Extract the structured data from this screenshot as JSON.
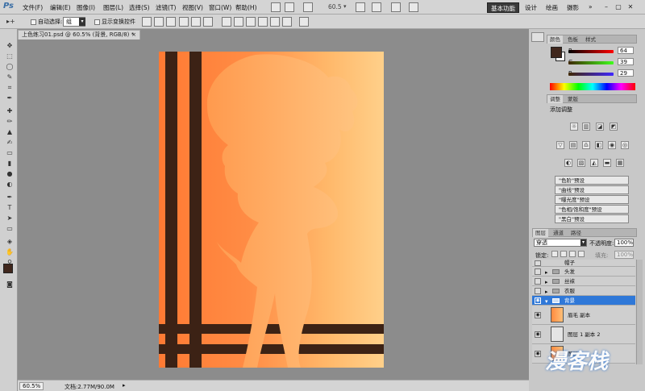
{
  "app": {
    "logo": "Ps"
  },
  "menu": [
    "文件(F)",
    "编辑(E)",
    "图像(I)",
    "图层(L)",
    "选择(S)",
    "滤镜(T)",
    "视图(V)",
    "窗口(W)",
    "帮助(H)"
  ],
  "app_toolbar": {
    "zoom": "60.5",
    "zoom_arrow": "▾"
  },
  "workspaces": [
    "基本功能",
    "设计",
    "绘画",
    "摄影"
  ],
  "workspace_more": "»",
  "window_controls": {
    "minimize": "–",
    "maximize": "▢",
    "close": "✕"
  },
  "options": {
    "tool_icon": "▸+",
    "auto_select_label": "自动选择:",
    "auto_select_value": "组",
    "transform_label": "显示变换控件"
  },
  "document": {
    "tab_title": "上色练习01.psd @ 60.5% (背景, RGB/8) *",
    "tab_close": "×",
    "zoom_status": "60.5%",
    "doc_status": "文档:2.77M/90.0M",
    "status_arrow": "▸"
  },
  "color_panel": {
    "tabs": [
      "颜色",
      "色板",
      "样式"
    ],
    "channels": [
      {
        "label": "R",
        "value": "64"
      },
      {
        "label": "G",
        "value": "39"
      },
      {
        "label": "B",
        "value": "29"
      }
    ],
    "foreground": "#40271d"
  },
  "adjust_panel": {
    "tabs": [
      "调整",
      "蒙版"
    ],
    "title": "添加调整",
    "presets": [
      "\"色阶\"预设",
      "\"曲线\"预设",
      "\"曝光度\"预设",
      "\"色相/饱和度\"预设",
      "\"黑白\"预设"
    ]
  },
  "layers_panel": {
    "tabs": [
      "图层",
      "通道",
      "路径"
    ],
    "blend_mode": "穿透",
    "opacity_label": "不透明度:",
    "opacity_value": "100%",
    "lock_label": "锁定:",
    "fill_label": "填充:",
    "fill_value": "100%",
    "layers": [
      {
        "name": "帽子",
        "kind": "group"
      },
      {
        "name": "头发",
        "kind": "group"
      },
      {
        "name": "丝袜",
        "kind": "group"
      },
      {
        "name": "衣服",
        "kind": "group"
      },
      {
        "name": "背景",
        "kind": "group",
        "selected": true
      },
      {
        "name": "眉毛 副本",
        "kind": "layer"
      },
      {
        "name": "图层 1 副本 2",
        "kind": "layer"
      },
      {
        "name": "图层",
        "kind": "layer"
      }
    ]
  },
  "watermark": "漫客栈",
  "colors": {
    "accent": "#2f78d8",
    "stripe": "#3c2215",
    "skin": "#ffc380",
    "bg": "#ff7a33"
  }
}
